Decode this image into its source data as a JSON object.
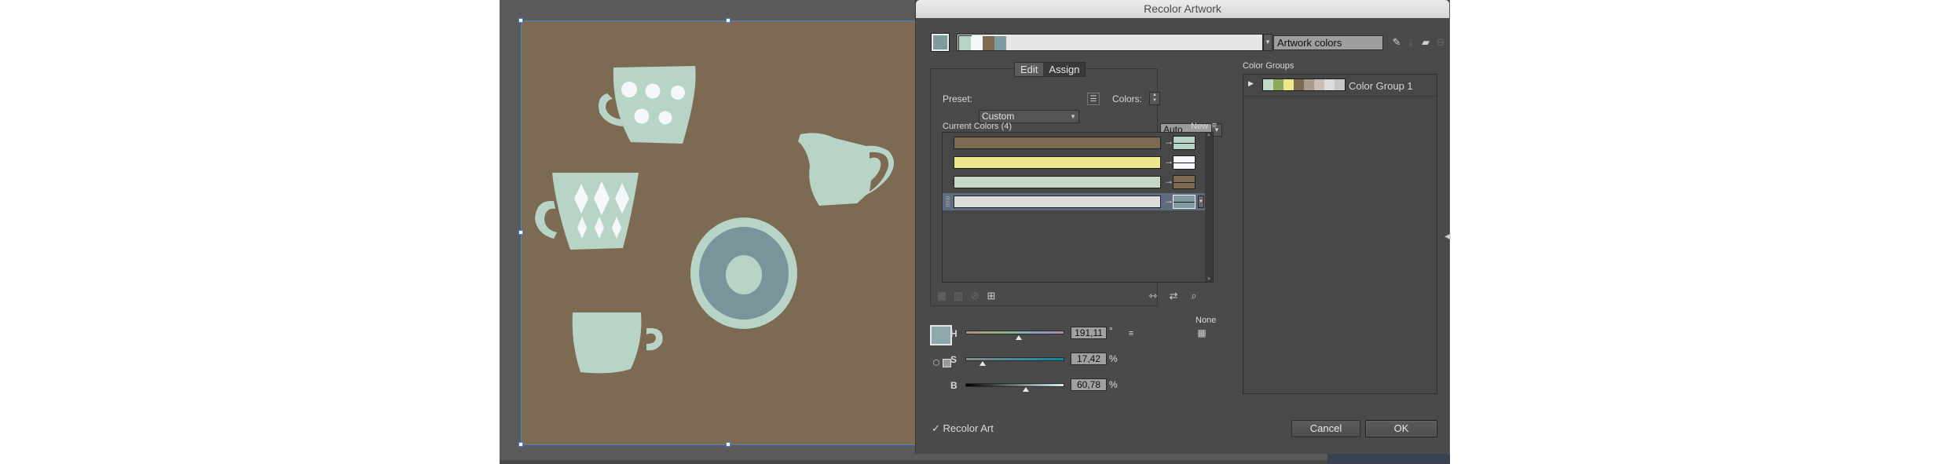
{
  "dialog": {
    "title": "Recolor Artwork",
    "harmony_swatches": [
      "#b8d4c6",
      "#f4f8fa",
      "#7c6a53",
      "#7f9ba0"
    ],
    "selected_swatch_color": "#7f9ba0",
    "color_group_name": "Artwork colors",
    "tabs": [
      {
        "label": "Edit",
        "active": false
      },
      {
        "label": "Assign",
        "active": true
      }
    ],
    "preset_label": "Preset:",
    "preset_value": "Custom",
    "colors_label": "Colors:",
    "colors_value": "Auto",
    "current_colors_label": "Current Colors (4)",
    "new_label": "New",
    "rows": [
      {
        "current": "#7c6a53",
        "new": [
          "#b8d4c6",
          "#b8d4c6"
        ],
        "selected": false
      },
      {
        "current": "#ece98a",
        "new": [
          "#f4f6fa",
          "#f4f6fa"
        ],
        "selected": false
      },
      {
        "current": "#c4d8c8",
        "new": [
          "#7c6a53",
          "#7c6a53"
        ],
        "selected": false
      },
      {
        "current": "#dcdcdc",
        "new": [
          "#7f9ba0",
          "#7f9ba0"
        ],
        "selected": true
      }
    ],
    "none_label": "None",
    "hsb": {
      "h_label": "H",
      "h_value": "191,11",
      "h_unit": "°",
      "h_fraction": 0.53,
      "s_label": "S",
      "s_value": "17,42",
      "s_unit": "%",
      "s_fraction": 0.17,
      "b_label": "B",
      "b_value": "60,78",
      "b_unit": "%",
      "b_fraction": 0.61
    },
    "current_color": "#8fa8ab",
    "recolor_art_label": "Recolor Art",
    "recolor_art_checked": true,
    "cancel_label": "Cancel",
    "ok_label": "OK",
    "color_groups_label": "Color Groups",
    "color_groups": [
      {
        "name": "Color Group 1",
        "swatches": [
          "#c4d8c8",
          "#8aa85e",
          "#ece98a",
          "#7c6a53",
          "#a89c8c",
          "#c8c0b4",
          "#dcdcdc",
          "#c8c8c8"
        ]
      }
    ]
  },
  "artwork": {
    "background": "#7c6a53",
    "fill": "#b8d4c6",
    "accent": "#f4f8fa",
    "plate_inner": "#77959b"
  }
}
